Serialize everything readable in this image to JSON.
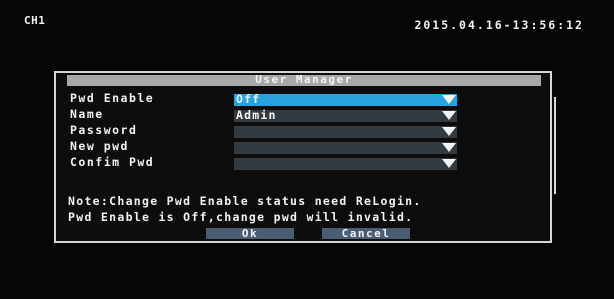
{
  "osd": {
    "channel": "CH1",
    "datetime": "2015.04.16-13:56:12"
  },
  "dialog": {
    "title": "User Manager",
    "fields": [
      {
        "label": "Pwd Enable",
        "value": "Off",
        "icon": "dropdown-arrow-icon"
      },
      {
        "label": "Name",
        "value": "Admin",
        "icon": "dropdown-arrow-icon"
      },
      {
        "label": "Password",
        "value": "",
        "icon": "dropdown-arrow-icon"
      },
      {
        "label": "New pwd",
        "value": "",
        "icon": "dropdown-arrow-icon"
      },
      {
        "label": "Confim Pwd",
        "value": "",
        "icon": "dropdown-arrow-icon"
      }
    ],
    "note_line_1": "Note:Change Pwd Enable status need ReLogin.",
    "note_line_2": "Pwd Enable is Off,change pwd will invalid.",
    "buttons": {
      "ok": "Ok",
      "cancel": "Cancel"
    }
  },
  "colors": {
    "active_field": "#27a4de",
    "inactive_field": "#343b40",
    "button": "#4a5d73",
    "title_bar": "#a8a8a8"
  }
}
